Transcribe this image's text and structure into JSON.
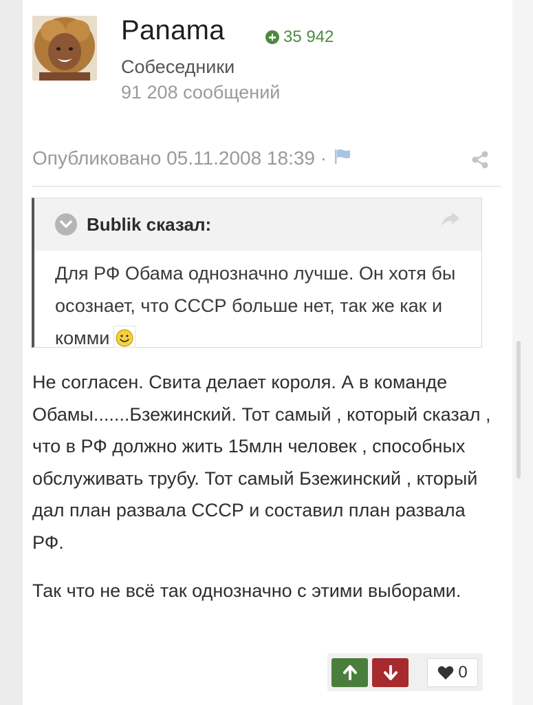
{
  "author": {
    "name": "Panama",
    "reputation": "35 942",
    "group": "Собеседники",
    "posts": "91 208 сообщений"
  },
  "meta": {
    "published": "Опубликовано 05.11.2008 18:39 ·"
  },
  "quote": {
    "author": "Bublik сказал:",
    "text": "Для РФ Обама однозначно лучше. Он хотя бы осознает, что СССР больше нет, так же как и комми"
  },
  "post": {
    "paragraphs": [
      "Не согласен. Свита делает короля. А в команде Обамы.......Бзежинский. Тот самый , который сказал , что в РФ должно жить 15млн человек , способных обслуживать трубу. Тот самый Бзежинский , кторый дал план развала СССР и составил план развала РФ.",
      "Так что не всё так однозначно с этими выборами."
    ]
  },
  "reactions": {
    "like_count": "0"
  },
  "colors": {
    "reputation": "#4d8a3f",
    "vote_up": "#4a7e3c",
    "vote_down": "#a72a2e"
  }
}
